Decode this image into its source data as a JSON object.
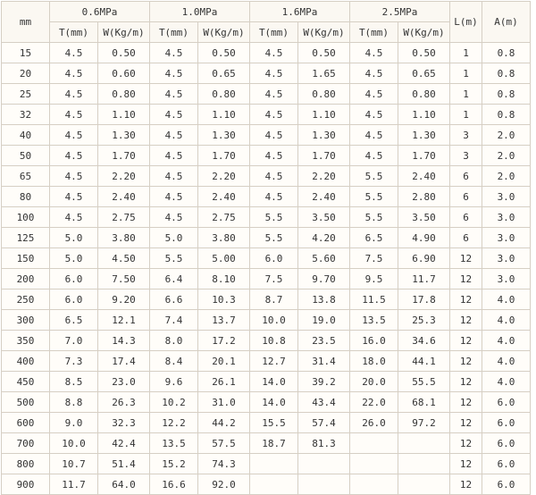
{
  "table": {
    "size_header": "mm",
    "pressure_headers": [
      "0.6MPa",
      "1.0MPa",
      "1.6MPa",
      "2.5MPa"
    ],
    "sub_headers": [
      "T(mm)",
      "W(Kg/m)"
    ],
    "length_header": "L(m)",
    "a_header": "A(m)",
    "rows": [
      [
        "15",
        "4.5",
        "0.50",
        "4.5",
        "0.50",
        "4.5",
        "0.50",
        "4.5",
        "0.50",
        "1",
        "0.8"
      ],
      [
        "20",
        "4.5",
        "0.60",
        "4.5",
        "0.65",
        "4.5",
        "1.65",
        "4.5",
        "0.65",
        "1",
        "0.8"
      ],
      [
        "25",
        "4.5",
        "0.80",
        "4.5",
        "0.80",
        "4.5",
        "0.80",
        "4.5",
        "0.80",
        "1",
        "0.8"
      ],
      [
        "32",
        "4.5",
        "1.10",
        "4.5",
        "1.10",
        "4.5",
        "1.10",
        "4.5",
        "1.10",
        "1",
        "0.8"
      ],
      [
        "40",
        "4.5",
        "1.30",
        "4.5",
        "1.30",
        "4.5",
        "1.30",
        "4.5",
        "1.30",
        "3",
        "2.0"
      ],
      [
        "50",
        "4.5",
        "1.70",
        "4.5",
        "1.70",
        "4.5",
        "1.70",
        "4.5",
        "1.70",
        "3",
        "2.0"
      ],
      [
        "65",
        "4.5",
        "2.20",
        "4.5",
        "2.20",
        "4.5",
        "2.20",
        "5.5",
        "2.40",
        "6",
        "2.0"
      ],
      [
        "80",
        "4.5",
        "2.40",
        "4.5",
        "2.40",
        "4.5",
        "2.40",
        "5.5",
        "2.80",
        "6",
        "3.0"
      ],
      [
        "100",
        "4.5",
        "2.75",
        "4.5",
        "2.75",
        "5.5",
        "3.50",
        "5.5",
        "3.50",
        "6",
        "3.0"
      ],
      [
        "125",
        "5.0",
        "3.80",
        "5.0",
        "3.80",
        "5.5",
        "4.20",
        "6.5",
        "4.90",
        "6",
        "3.0"
      ],
      [
        "150",
        "5.0",
        "4.50",
        "5.5",
        "5.00",
        "6.0",
        "5.60",
        "7.5",
        "6.90",
        "12",
        "3.0"
      ],
      [
        "200",
        "6.0",
        "7.50",
        "6.4",
        "8.10",
        "7.5",
        "9.70",
        "9.5",
        "11.7",
        "12",
        "3.0"
      ],
      [
        "250",
        "6.0",
        "9.20",
        "6.6",
        "10.3",
        "8.7",
        "13.8",
        "11.5",
        "17.8",
        "12",
        "4.0"
      ],
      [
        "300",
        "6.5",
        "12.1",
        "7.4",
        "13.7",
        "10.0",
        "19.0",
        "13.5",
        "25.3",
        "12",
        "4.0"
      ],
      [
        "350",
        "7.0",
        "14.3",
        "8.0",
        "17.2",
        "10.8",
        "23.5",
        "16.0",
        "34.6",
        "12",
        "4.0"
      ],
      [
        "400",
        "7.3",
        "17.4",
        "8.4",
        "20.1",
        "12.7",
        "31.4",
        "18.0",
        "44.1",
        "12",
        "4.0"
      ],
      [
        "450",
        "8.5",
        "23.0",
        "9.6",
        "26.1",
        "14.0",
        "39.2",
        "20.0",
        "55.5",
        "12",
        "4.0"
      ],
      [
        "500",
        "8.8",
        "26.3",
        "10.2",
        "31.0",
        "14.0",
        "43.4",
        "22.0",
        "68.1",
        "12",
        "6.0"
      ],
      [
        "600",
        "9.0",
        "32.3",
        "12.2",
        "44.2",
        "15.5",
        "57.4",
        "26.0",
        "97.2",
        "12",
        "6.0"
      ],
      [
        "700",
        "10.0",
        "42.4",
        "13.5",
        "57.5",
        "18.7",
        "81.3",
        "",
        "",
        "12",
        "6.0"
      ],
      [
        "800",
        "10.7",
        "51.4",
        "15.2",
        "74.3",
        "",
        "",
        "",
        "",
        "12",
        "6.0"
      ],
      [
        "900",
        "11.7",
        "64.0",
        "16.6",
        "92.0",
        "",
        "",
        "",
        "",
        "12",
        "6.0"
      ]
    ]
  }
}
